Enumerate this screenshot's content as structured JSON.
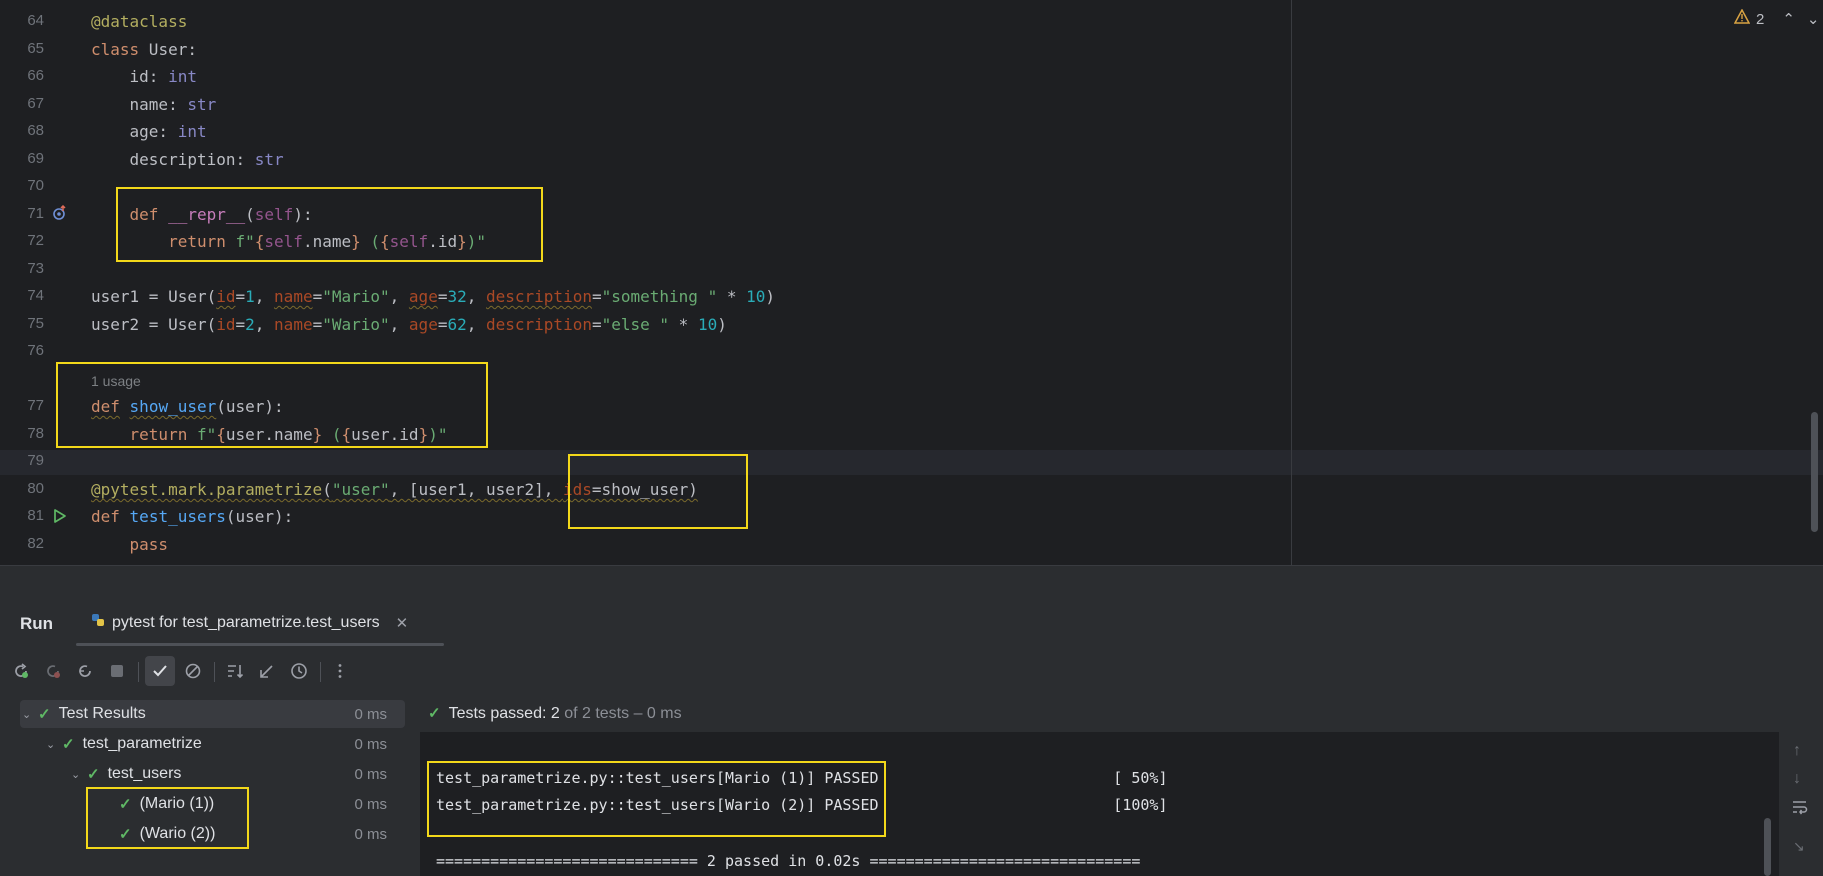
{
  "editor": {
    "warning_count": "2",
    "inlay_usage": "1 usage",
    "lines": [
      {
        "no": "64"
      },
      {
        "no": "65"
      },
      {
        "no": "66"
      },
      {
        "no": "67"
      },
      {
        "no": "68"
      },
      {
        "no": "69"
      },
      {
        "no": "70"
      },
      {
        "no": "71"
      },
      {
        "no": "72"
      },
      {
        "no": "73"
      },
      {
        "no": "74"
      },
      {
        "no": "75"
      },
      {
        "no": "76"
      },
      {
        "no": "77"
      },
      {
        "no": "78"
      },
      {
        "no": "79"
      },
      {
        "no": "80"
      },
      {
        "no": "81"
      },
      {
        "no": "82"
      }
    ],
    "code": {
      "l64": [
        "@dataclass"
      ],
      "l65": [
        "class",
        " User:"
      ],
      "l66": [
        "    id: ",
        "int"
      ],
      "l67": [
        "    name: ",
        "str"
      ],
      "l68": [
        "    age: ",
        "int"
      ],
      "l69": [
        "    description: ",
        "str"
      ],
      "l71": [
        "    ",
        "def",
        " ",
        "__repr__",
        "(",
        "self",
        "):"
      ],
      "l72": [
        "        ",
        "return",
        " ",
        "f\"",
        "{",
        "self",
        ".name",
        "}",
        " (",
        "{",
        "self",
        ".id",
        "}",
        ")\""
      ],
      "l74": [
        "user1 = User(",
        "id",
        "=",
        "1",
        ", ",
        "name",
        "=",
        "\"Mario\"",
        ", ",
        "age",
        "=",
        "32",
        ", ",
        "description",
        "=",
        "\"something \"",
        " * ",
        "10",
        ")"
      ],
      "l75": [
        "user2 = User(",
        "id",
        "=",
        "2",
        ", ",
        "name",
        "=",
        "\"Wario\"",
        ", ",
        "age",
        "=",
        "62",
        ", ",
        "description",
        "=",
        "\"else \"",
        " * ",
        "10",
        ")"
      ],
      "l77": [
        "def",
        " ",
        "show_user",
        "(user):"
      ],
      "l78": [
        "    ",
        "return",
        " ",
        "f\"",
        "{",
        "user.name",
        "}",
        " (",
        "{",
        "user.id",
        "}",
        ")\""
      ],
      "l80": [
        "@pytest.mark.parametrize",
        "(",
        "\"user\"",
        ", [user1, user2], ",
        "ids",
        "=show_user)"
      ],
      "l81": [
        "def",
        " ",
        "test_users",
        "(user):"
      ],
      "l82": [
        "    ",
        "pass"
      ]
    }
  },
  "run_panel": {
    "title": "Run",
    "tab_label": "pytest for test_parametrize.test_users",
    "tree": [
      {
        "label": "Test Results",
        "time": "0 ms"
      },
      {
        "label": "test_parametrize",
        "time": "0 ms"
      },
      {
        "label": "test_users",
        "time": "0 ms"
      },
      {
        "label": "(Mario (1))",
        "time": "0 ms"
      },
      {
        "label": "(Wario (2))",
        "time": "0 ms"
      }
    ],
    "status": {
      "passed": "Tests passed: 2",
      "rest": " of 2 tests – 0 ms"
    },
    "console": [
      "test_parametrize.py::test_users[Mario (1)] PASSED                          [ 50%]",
      "test_parametrize.py::test_users[Wario (2)] PASSED                          [100%]",
      "============================= 2 passed in 0.02s =============================="
    ]
  },
  "colors": {
    "highlight": "#f3d81a",
    "pass": "#5fb865"
  }
}
